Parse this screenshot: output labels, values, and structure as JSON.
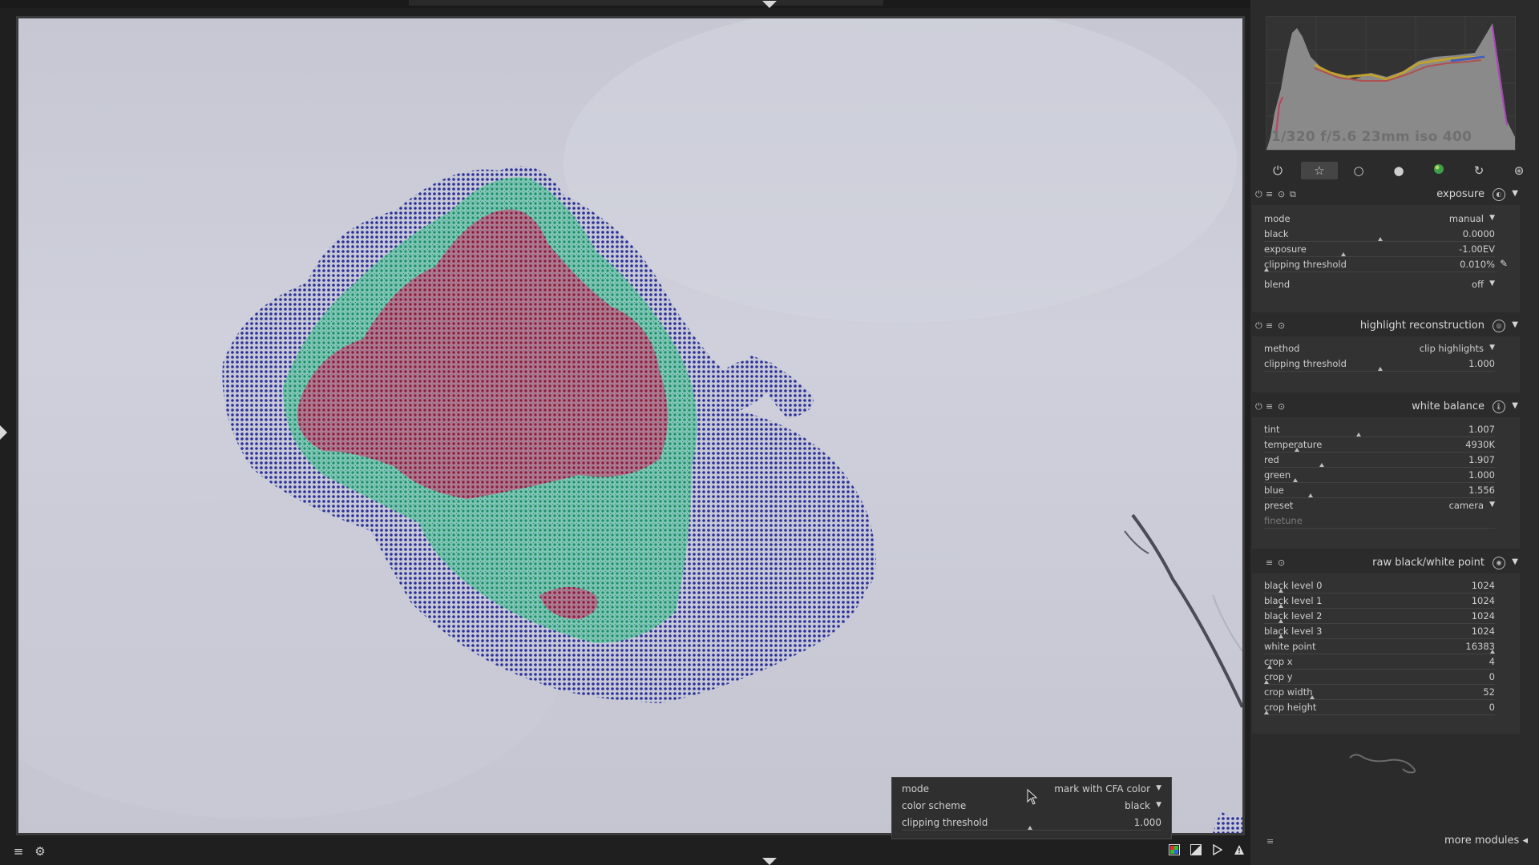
{
  "histogram": {
    "info": "1/320 f/5.6 23mm iso 400"
  },
  "module_groups": [
    "power-icon",
    "star-icon",
    "circle-icon",
    "sphere-icon",
    "color-icon",
    "correct-icon",
    "effect-icon"
  ],
  "modules": {
    "exposure": {
      "title": "exposure",
      "rows": {
        "mode": {
          "label": "mode",
          "value": "manual"
        },
        "black": {
          "label": "black",
          "value": "0.0000"
        },
        "exposure": {
          "label": "exposure",
          "value": "-1.00EV"
        },
        "clipping": {
          "label": "clipping threshold",
          "value": "0.010%"
        },
        "blend": {
          "label": "blend",
          "value": "off"
        }
      }
    },
    "highlight": {
      "title": "highlight reconstruction",
      "rows": {
        "method": {
          "label": "method",
          "value": "clip highlights"
        },
        "clipping": {
          "label": "clipping threshold",
          "value": "1.000"
        }
      }
    },
    "white_balance": {
      "title": "white balance",
      "rows": {
        "tint": {
          "label": "tint",
          "value": "1.007"
        },
        "temperature": {
          "label": "temperature",
          "value": "4930K"
        },
        "red": {
          "label": "red",
          "value": "1.907"
        },
        "green": {
          "label": "green",
          "value": "1.000"
        },
        "blue": {
          "label": "blue",
          "value": "1.556"
        },
        "preset": {
          "label": "preset",
          "value": "camera"
        },
        "finetune": {
          "label": "finetune",
          "value": ""
        }
      }
    },
    "raw_bw": {
      "title": "raw black/white point",
      "rows": {
        "bl0": {
          "label": "black level 0",
          "value": "1024"
        },
        "bl1": {
          "label": "black level 1",
          "value": "1024"
        },
        "bl2": {
          "label": "black level 2",
          "value": "1024"
        },
        "bl3": {
          "label": "black level 3",
          "value": "1024"
        },
        "wp": {
          "label": "white point",
          "value": "16383"
        },
        "cx": {
          "label": "crop x",
          "value": "4"
        },
        "cy": {
          "label": "crop y",
          "value": "0"
        },
        "cw": {
          "label": "crop width",
          "value": "52"
        },
        "ch": {
          "label": "crop height",
          "value": "0"
        }
      }
    }
  },
  "more_modules": "more modules",
  "popup": {
    "mode": {
      "label": "mode",
      "value": "mark with CFA color"
    },
    "scheme": {
      "label": "color scheme",
      "value": "black"
    },
    "clipping": {
      "label": "clipping threshold",
      "value": "1.000"
    }
  },
  "bottom_icons": [
    "menu-icon",
    "styles-icon",
    "raw-overexposed-icon",
    "overexposed-icon",
    "softproof-icon",
    "gamut-check-icon"
  ]
}
